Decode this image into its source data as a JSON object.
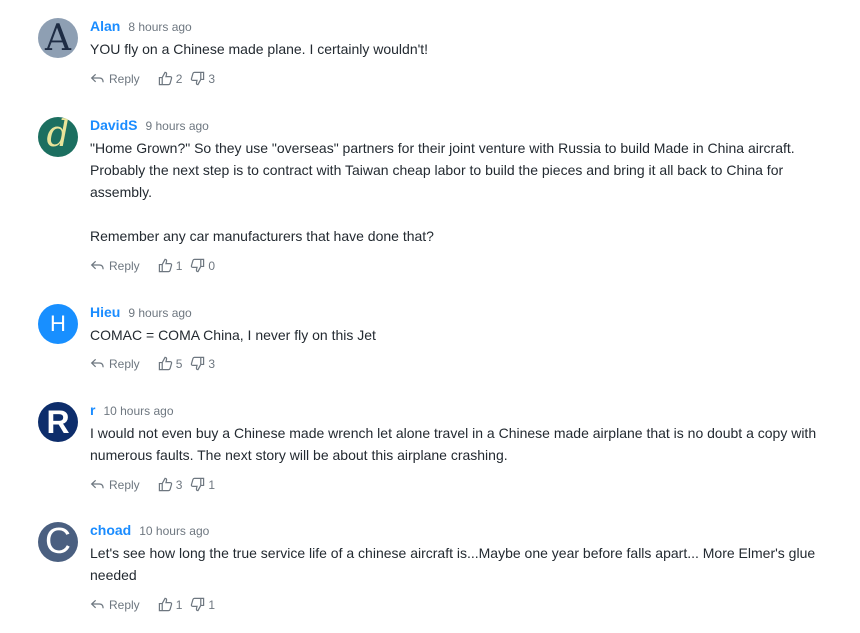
{
  "comments": [
    {
      "author": "Alan",
      "time": "8 hours ago",
      "avatar_letter": "A",
      "body": [
        "YOU fly on a Chinese made plane. I certainly wouldn't!"
      ],
      "reply_label": "Reply",
      "likes": "2",
      "dislikes": "3"
    },
    {
      "author": "DavidS",
      "time": "9 hours ago",
      "avatar_letter": "d",
      "body": [
        "\"Home Grown?\" So they use \"overseas\" partners for their joint venture with Russia to build Made in China aircraft. Probably the next step is to contract with Taiwan cheap labor to build the pieces and bring it all back to China for assembly.",
        "Remember any car manufacturers that have done that?"
      ],
      "reply_label": "Reply",
      "likes": "1",
      "dislikes": "0"
    },
    {
      "author": "Hieu",
      "time": "9 hours ago",
      "avatar_letter": "H",
      "body": [
        "COMAC = COMA China, I never fly on this Jet"
      ],
      "reply_label": "Reply",
      "likes": "5",
      "dislikes": "3"
    },
    {
      "author": "r",
      "time": "10 hours ago",
      "avatar_letter": "R",
      "body": [
        "I would not even buy a Chinese made wrench let alone travel in a Chinese made airplane that is no doubt a copy with numerous faults. The next story will be about this airplane crashing."
      ],
      "reply_label": "Reply",
      "likes": "3",
      "dislikes": "1"
    },
    {
      "author": "choad",
      "time": "10 hours ago",
      "avatar_letter": "C",
      "body": [
        "Let's see how long the true service life of a chinese aircraft is...Maybe one year before falls apart... More Elmer's glue needed"
      ],
      "reply_label": "Reply",
      "likes": "1",
      "dislikes": "1"
    }
  ],
  "icons": {
    "avatar_colors": [
      "#8e9fb3",
      "#1c6f60",
      "#188fff",
      "#0d2d6b",
      "#4a5f80"
    ],
    "author_color": "#1a8cff"
  }
}
